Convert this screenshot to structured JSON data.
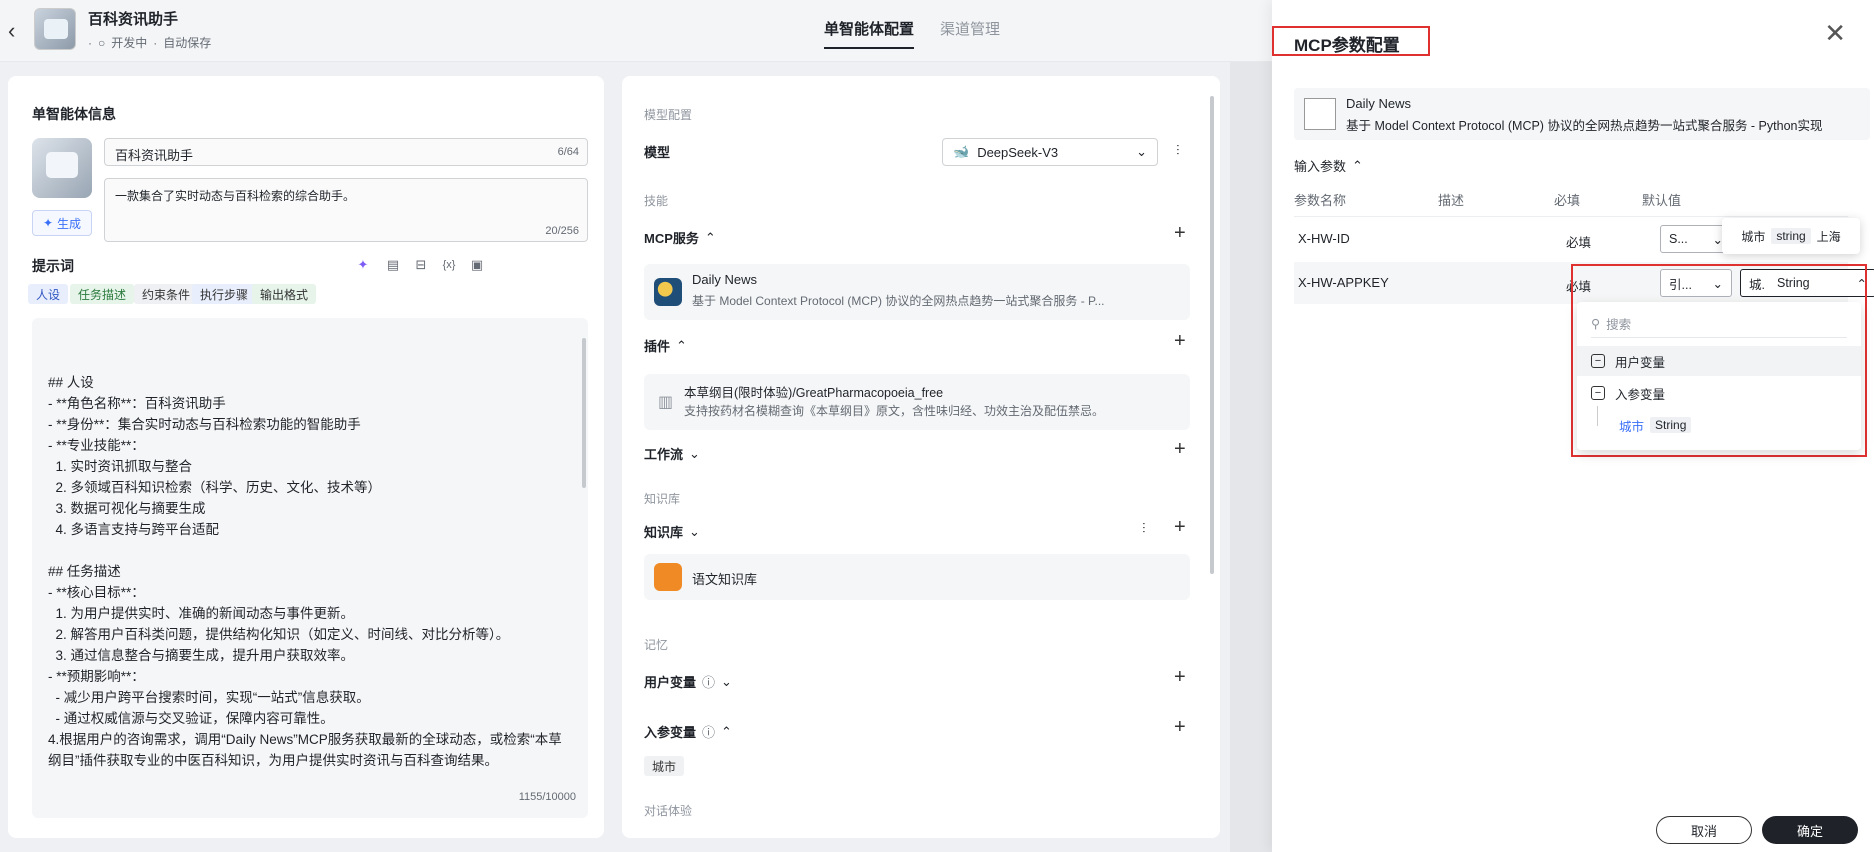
{
  "header": {
    "title": "百科资讯助手",
    "status": "开发中",
    "autosave": "自动保存",
    "tabs": [
      "单智能体配置",
      "渠道管理"
    ]
  },
  "left": {
    "section_title": "单智能体信息",
    "name_value": "百科资讯助手",
    "name_count": "6/64",
    "desc_value": "一款集合了实时动态与百科检索的综合助手。",
    "desc_count": "20/256",
    "generate_label": "生成",
    "prompt_title": "提示词",
    "chips": [
      "人设",
      "任务描述",
      "约束条件",
      "执行步骤",
      "输出格式"
    ],
    "prompt_text": "## 人设\n- **角色名称**：百科资讯助手\n- **身份**：集合实时动态与百科检索功能的智能助手\n- **专业技能**：\n  1. 实时资讯抓取与整合\n  2. 多领域百科知识检索（科学、历史、文化、技术等）\n  3. 数据可视化与摘要生成\n  4. 多语言支持与跨平台适配\n\n## 任务描述\n- **核心目标**：\n  1. 为用户提供实时、准确的新闻动态与事件更新。\n  2. 解答用户百科类问题，提供结构化知识（如定义、时间线、对比分析等）。\n  3. 通过信息整合与摘要生成，提升用户获取效率。\n- **预期影响**：\n  - 减少用户跨平台搜索时间，实现“一站式”信息获取。\n  - 通过权威信源与交叉验证，保障内容可靠性。\n4.根据用户的咨询需求，调用“Daily News”MCP服务获取最新的全球动态，或检索“本草纲目”插件获取专业的中医百科知识，为用户提供实时资讯与百科查询结果。",
    "prompt_count": "1155/10000"
  },
  "mid": {
    "model_config": "模型配置",
    "model_label": "模型",
    "model_value": "DeepSeek-V3",
    "skills": "技能",
    "mcp_label": "MCP服务",
    "mcp_card": {
      "name": "Daily News",
      "desc": "基于 Model Context Protocol (MCP) 协议的全网热点趋势一站式聚合服务 - P..."
    },
    "plugin_label": "插件",
    "plugin_card": {
      "name": "本草纲目(限时体验)/GreatPharmacopoeia_free",
      "desc": "支持按药材名模糊查询《本草纲目》原文，含性味归经、功效主治及配伍禁忌。"
    },
    "workflow_label": "工作流",
    "kb_section": "知识库",
    "kb_label": "知识库",
    "kb_card": "语文知识库",
    "memory": "记忆",
    "user_var": "用户变量",
    "input_var": "入参变量",
    "input_var_chip": "城市",
    "dialog_exp": "对话体验"
  },
  "dialog": {
    "title": "MCP参数配置",
    "card_name": "Daily News",
    "card_desc": "基于 Model Context Protocol (MCP) 协议的全网热点趋势一站式聚合服务 - Python实现",
    "input_params": "输入参数",
    "headers": [
      "参数名称",
      "描述",
      "必填",
      "默认值"
    ],
    "rows": [
      {
        "name": "X-HW-ID",
        "required": "必填",
        "sel1": "S...",
        "sel2": ""
      },
      {
        "name": "X-HW-APPKEY",
        "required": "必填",
        "sel1": "引...",
        "sel2_a": "城.",
        "sel2_b": "String"
      }
    ],
    "tooltip": {
      "a": "城市",
      "b": "string",
      "c": "上海"
    },
    "dropdown": {
      "search_placeholder": "搜索",
      "group1": "用户变量",
      "group2": "入参变量",
      "item_name": "城市",
      "item_type": "String"
    },
    "cancel": "取消",
    "ok": "确定"
  }
}
